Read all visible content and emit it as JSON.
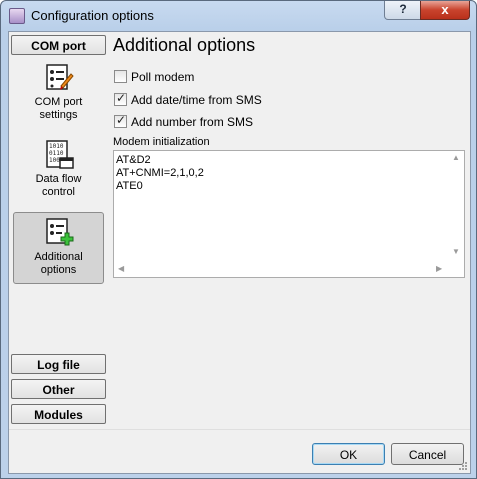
{
  "window": {
    "title": "Configuration options",
    "help_glyph": "?",
    "close_glyph": "x"
  },
  "sidebar": {
    "top_section": "COM port",
    "items": [
      {
        "label": "COM port settings",
        "icon": "settings-checklist-icon"
      },
      {
        "label": "Data flow control",
        "icon": "binary-data-icon"
      },
      {
        "label": "Additional options",
        "icon": "add-options-icon",
        "selected": true
      }
    ],
    "bottom_sections": [
      "Log file",
      "Other",
      "Modules"
    ]
  },
  "main": {
    "title": "Additional options",
    "checkboxes": [
      {
        "label": "Poll modem",
        "checked": false
      },
      {
        "label": "Add date/time from SMS",
        "checked": true
      },
      {
        "label": "Add number from SMS",
        "checked": true
      }
    ],
    "modem_init_label": "Modem initialization",
    "modem_init_text": "AT&D2\nAT+CNMI=2,1,0,2\nATE0"
  },
  "buttons": {
    "ok": "OK",
    "cancel": "Cancel"
  },
  "colors": {
    "title_bar": "#bcd1ea",
    "close_button": "#c9432d",
    "selected_item": "#d4d4d4"
  }
}
